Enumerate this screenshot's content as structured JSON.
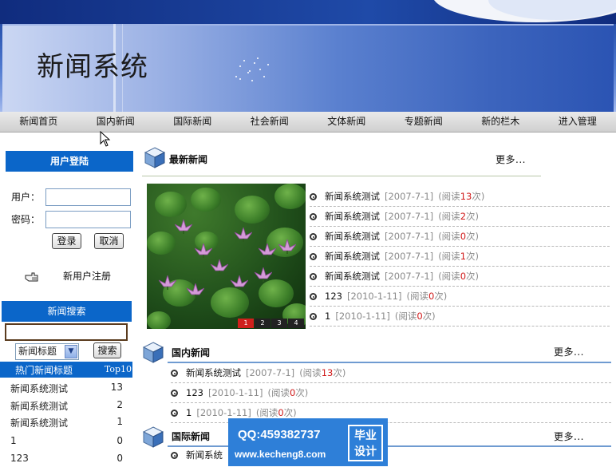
{
  "header": {
    "title": "新闻系统"
  },
  "nav": {
    "items": [
      "新闻首页",
      "国内新闻",
      "国际新闻",
      "社会新闻",
      "文体新闻",
      "专题新闻",
      "新的栏木",
      "进入管理"
    ]
  },
  "login": {
    "title": "用户登陆",
    "username_label": "用户：",
    "password_label": "密码：",
    "username_value": "",
    "password_value": "",
    "login_button": "登录",
    "cancel_button": "取消",
    "register_link": "新用户注册"
  },
  "search": {
    "title": "新闻搜索",
    "query": "",
    "select_value": "新闻标题",
    "button": "搜索"
  },
  "hot": {
    "title": "热门新闻标题",
    "badge": "Top10",
    "items": [
      {
        "title": "新闻系统测试",
        "count": "13"
      },
      {
        "title": "新闻系统测试",
        "count": "2"
      },
      {
        "title": "新闻系统测试",
        "count": "1"
      },
      {
        "title": "1",
        "count": "0"
      },
      {
        "title": "123",
        "count": "0"
      }
    ]
  },
  "latest": {
    "title": "最新新闻",
    "more": "更多...",
    "pager": [
      "1",
      "2",
      "3",
      "4"
    ],
    "items": [
      {
        "title": "新闻系统测试",
        "date": "[2007-7-1]",
        "read_prefix": "(阅读",
        "count": "13",
        "read_suffix": "次)"
      },
      {
        "title": "新闻系统测试",
        "date": "[2007-7-1]",
        "read_prefix": "(阅读",
        "count": "2",
        "read_suffix": "次)"
      },
      {
        "title": "新闻系统测试",
        "date": "[2007-7-1]",
        "read_prefix": "(阅读",
        "count": "0",
        "read_suffix": "次)"
      },
      {
        "title": "新闻系统测试",
        "date": "[2007-7-1]",
        "read_prefix": "(阅读",
        "count": "1",
        "read_suffix": "次)"
      },
      {
        "title": "新闻系统测试",
        "date": "[2007-7-1]",
        "read_prefix": "(阅读",
        "count": "0",
        "read_suffix": "次)"
      },
      {
        "title": "123",
        "date": "[2010-1-11]",
        "read_prefix": "(阅读",
        "count": "0",
        "read_suffix": "次)"
      },
      {
        "title": "1",
        "date": "[2010-1-11]",
        "read_prefix": "(阅读",
        "count": "0",
        "read_suffix": "次)"
      }
    ]
  },
  "domestic": {
    "title": "国内新闻",
    "more": "更多...",
    "items": [
      {
        "title": "新闻系统测试",
        "date": "[2007-7-1]",
        "read_prefix": "(阅读",
        "count": "13",
        "read_suffix": "次)"
      },
      {
        "title": "123",
        "date": "[2010-1-11]",
        "read_prefix": "(阅读",
        "count": "0",
        "read_suffix": "次)"
      },
      {
        "title": "1",
        "date": "[2010-1-11]",
        "read_prefix": "(阅读",
        "count": "0",
        "read_suffix": "次)"
      }
    ]
  },
  "international": {
    "title": "国际新闻",
    "more": "更多...",
    "items": [
      {
        "title": "新闻系统"
      }
    ]
  },
  "watermark": {
    "qq": "QQ:459382737",
    "site": "www.kecheng8.com",
    "badge_line1": "毕业",
    "badge_line2": "设计"
  }
}
